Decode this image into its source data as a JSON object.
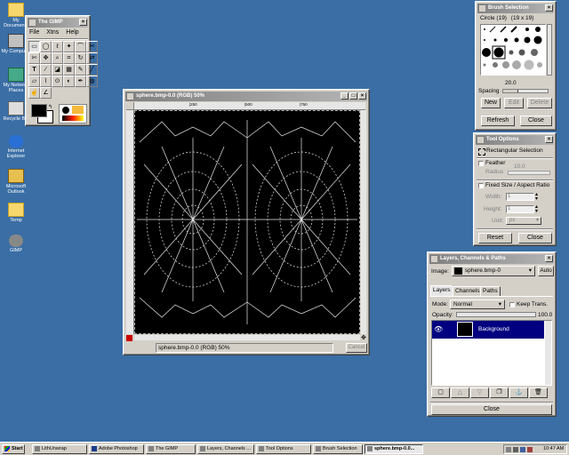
{
  "desktop": {
    "icons": [
      {
        "label": "My Documents",
        "icon": "folder-icon"
      },
      {
        "label": "My Computer",
        "icon": "computer-icon"
      },
      {
        "label": "My Network Places",
        "icon": "network-icon"
      },
      {
        "label": "Recycle Bin",
        "icon": "recycle-bin-icon"
      },
      {
        "label": "Internet Explorer",
        "icon": "ie-icon"
      },
      {
        "label": "Microsoft Outlook",
        "icon": "outlook-icon"
      },
      {
        "label": "Temp",
        "icon": "folder-icon"
      },
      {
        "label": "GIMP",
        "icon": "gimp-icon"
      }
    ],
    "background_color": "#3a6ea5"
  },
  "toolbox": {
    "title": "The GIMP",
    "menu": [
      "File",
      "Xtns",
      "Help"
    ],
    "tools": [
      "rect-select",
      "ellipse-select",
      "free-select",
      "fuzzy-select",
      "bezier-select",
      "scissors",
      "iscissors",
      "move",
      "magnify",
      "crop",
      "transform",
      "flip",
      "text",
      "color-picker",
      "bucket-fill",
      "blend",
      "pencil",
      "paintbrush",
      "eraser",
      "airbrush",
      "clone",
      "convolve",
      "ink",
      "dodge-burn",
      "smudge",
      "measure",
      "path",
      "zoom",
      "",
      ""
    ],
    "fg_color": "#000000",
    "bg_color": "#ffffff"
  },
  "image_window": {
    "title": "sphere.bmp-0.0 (RGB) 50%",
    "status": "sphere.bmp-0.0 (RGB) 50%",
    "cancel_label": "Cancel",
    "ruler_marks": [
      "|250",
      "|500",
      "|750"
    ]
  },
  "brush_window": {
    "title": "Brush Selection",
    "brush_name": "Circle (19)",
    "brush_size": "(19 x 19)",
    "spacing_value": "20.0",
    "spacing_label": "Spacing",
    "new_label": "New",
    "edit_label": "Edit",
    "delete_label": "Delete",
    "refresh_label": "Refresh",
    "close_label": "Close"
  },
  "tool_options": {
    "title": "Tool Options",
    "tool_name": "Rectangular Selection",
    "feather_label": "Feather",
    "radius_label": "Radius",
    "radius_value": "10.0",
    "fixed_label": "Fixed Size / Aspect Ratio",
    "width_label": "Width:",
    "width_value": "1",
    "height_label": "Height:",
    "height_value": "1",
    "unit_label": "Unit:",
    "unit_value": "px",
    "reset_label": "Reset",
    "close_label": "Close"
  },
  "layers": {
    "title": "Layers, Channels & Paths",
    "image_label": "Image:",
    "image_value": "sphere.bmp-0",
    "auto_label": "Auto",
    "tabs": [
      "Layers",
      "Channels",
      "Paths"
    ],
    "mode_label": "Mode:",
    "mode_value": "Normal",
    "keep_trans_label": "Keep Trans.",
    "opacity_label": "Opacity:",
    "opacity_value": "100.0",
    "layer_name": "Background",
    "close_label": "Close"
  },
  "taskbar": {
    "start_label": "Start",
    "items": [
      "LithUnwrap",
      "Adobe Photoshop",
      "The GIMP",
      "Layers, Channels ...",
      "Tool Options",
      "Brush Selection",
      "sphere.bmp-0.0..."
    ],
    "clock": "10:47 AM"
  }
}
